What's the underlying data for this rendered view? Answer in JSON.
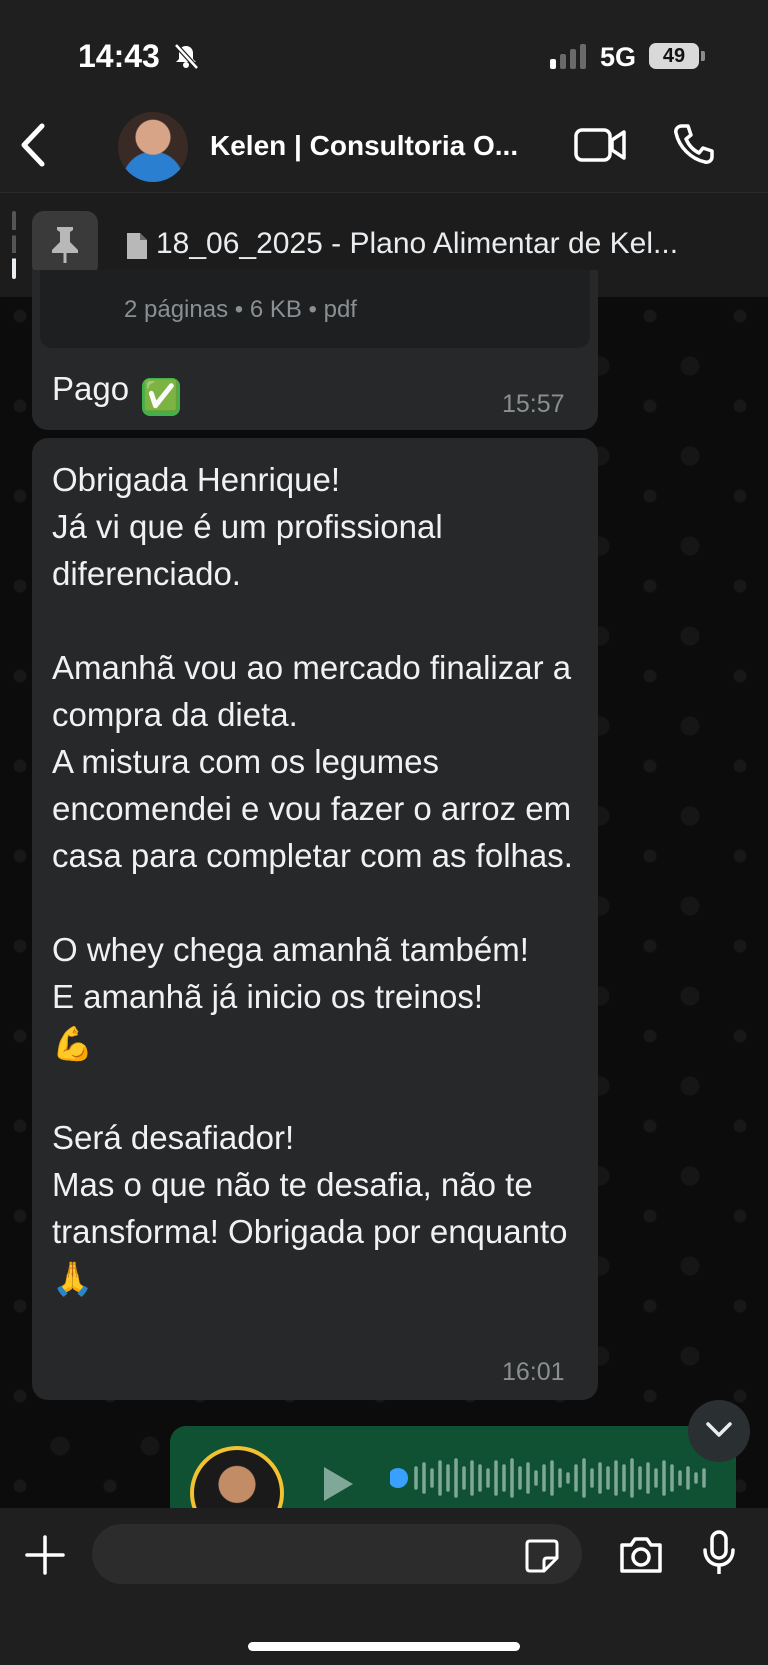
{
  "status_bar": {
    "time": "14:43",
    "network": "5G",
    "battery": "49"
  },
  "header": {
    "contact_name": "Kelen | Consultoria O..."
  },
  "pinned": {
    "text": "18_06_2025 - Plano Alimentar de Kel..."
  },
  "messages": [
    {
      "doc_meta": "2 páginas • 6 KB • pdf",
      "text": "Pago",
      "emoji": "✅",
      "time": "15:57"
    },
    {
      "text": "Obrigada Henrique!\nJá vi que é um profissional diferenciado.\n\nAmanhã vou ao mercado finalizar a compra da dieta.\nA mistura com os legumes encomendei e vou fazer o arroz em casa para completar com as folhas.\n\nO whey chega amanhã também!\nE amanhã já inicio os treinos!\n💪\n\nSerá desafiador!\nMas o que não te desafia, não te transforma! Obrigada por enquanto 🙏",
      "time": "16:01"
    }
  ],
  "composer": {
    "placeholder": ""
  },
  "colors": {
    "bubble_incoming": "#262829",
    "bubble_outgoing": "#0f5132",
    "accent": "#2d8cff"
  }
}
